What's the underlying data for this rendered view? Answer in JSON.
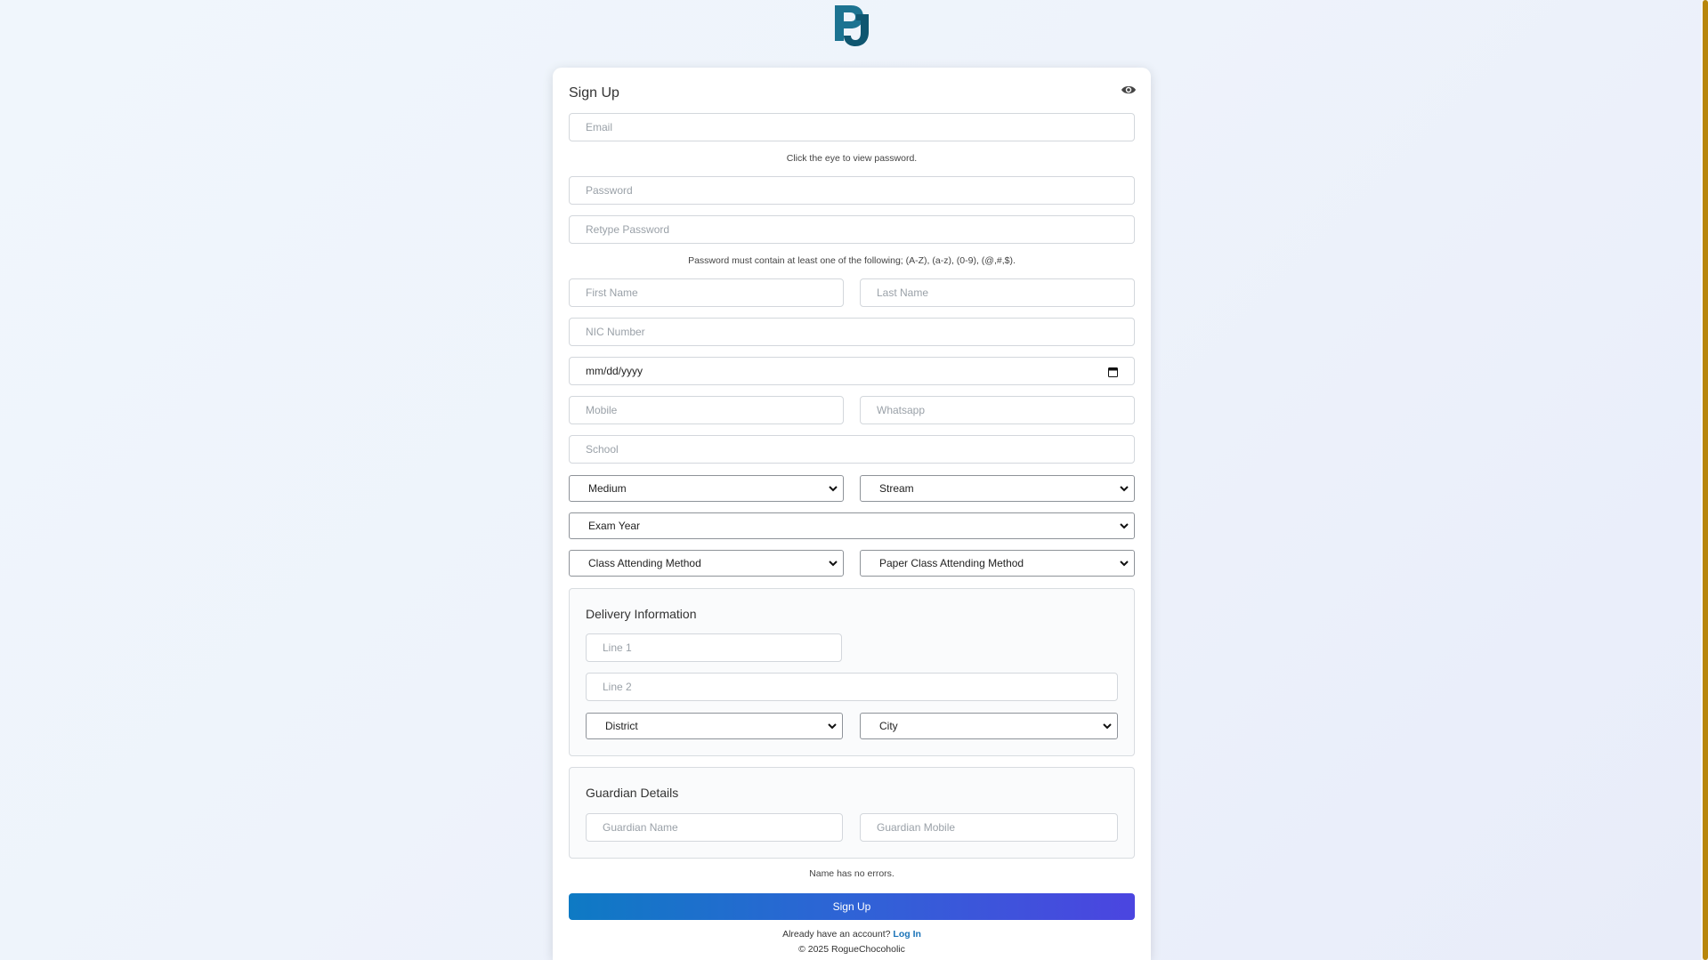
{
  "logo": {
    "icon": "pj-logo-icon",
    "colors": [
      "#1a6f8a",
      "#0f4a66"
    ]
  },
  "card": {
    "title": "Sign Up",
    "eye_icon": "eye-icon",
    "email_placeholder": "Email",
    "eye_hint": "Click the eye to view password.",
    "password_placeholder": "Password",
    "retype_placeholder": "Retype Password",
    "password_rule": "Password must contain at least one of the following; (A-Z), (a-z), (0-9), (@,#,$).",
    "first_name_placeholder": "First Name",
    "last_name_placeholder": "Last Name",
    "nic_placeholder": "NIC Number",
    "dob_value": "mm/dd/yyyy",
    "mobile_placeholder": "Mobile",
    "whatsapp_placeholder": "Whatsapp",
    "school_placeholder": "School",
    "medium_select": "Medium",
    "stream_select": "Stream",
    "exam_year_select": "Exam Year",
    "class_method_select": "Class Attending Method",
    "paper_method_select": "Paper Class Attending Method"
  },
  "delivery": {
    "title": "Delivery Information",
    "line1_placeholder": "Line 1",
    "line2_placeholder": "Line 2",
    "district_select": "District",
    "city_select": "City"
  },
  "guardian": {
    "title": "Guardian Details",
    "name_placeholder": "Guardian Name",
    "mobile_placeholder": "Guardian Mobile"
  },
  "status_text": "Name has no errors.",
  "submit_label": "Sign Up",
  "login_prompt": "Already have an account?",
  "login_link": "Log In",
  "copyright": "© 2025 RogueChocoholic",
  "colors": {
    "accent_start": "#0e7ac4",
    "accent_end": "#4b45e0",
    "link": "#1a73b8",
    "scrollbar": "#b8860b"
  }
}
